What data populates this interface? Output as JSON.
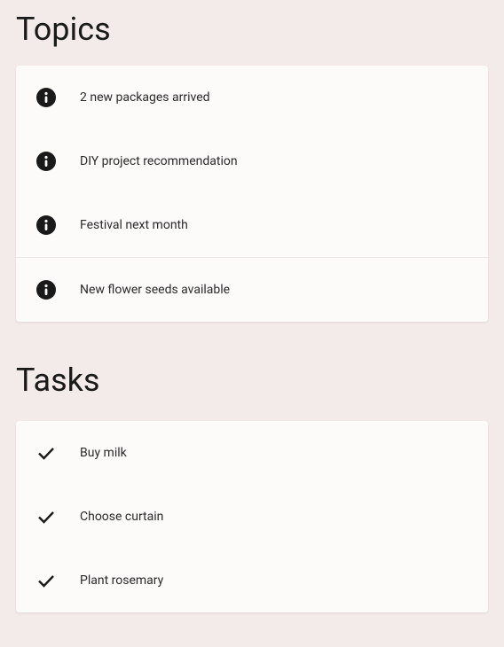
{
  "sections": {
    "topics": {
      "title": "Topics",
      "items": [
        {
          "label": "2 new packages arrived"
        },
        {
          "label": "DIY project recommendation"
        },
        {
          "label": "Festival next month"
        },
        {
          "label": "New flower seeds available"
        }
      ]
    },
    "tasks": {
      "title": "Tasks",
      "items": [
        {
          "label": "Buy milk"
        },
        {
          "label": "Choose curtain"
        },
        {
          "label": "Plant rosemary"
        }
      ]
    }
  }
}
